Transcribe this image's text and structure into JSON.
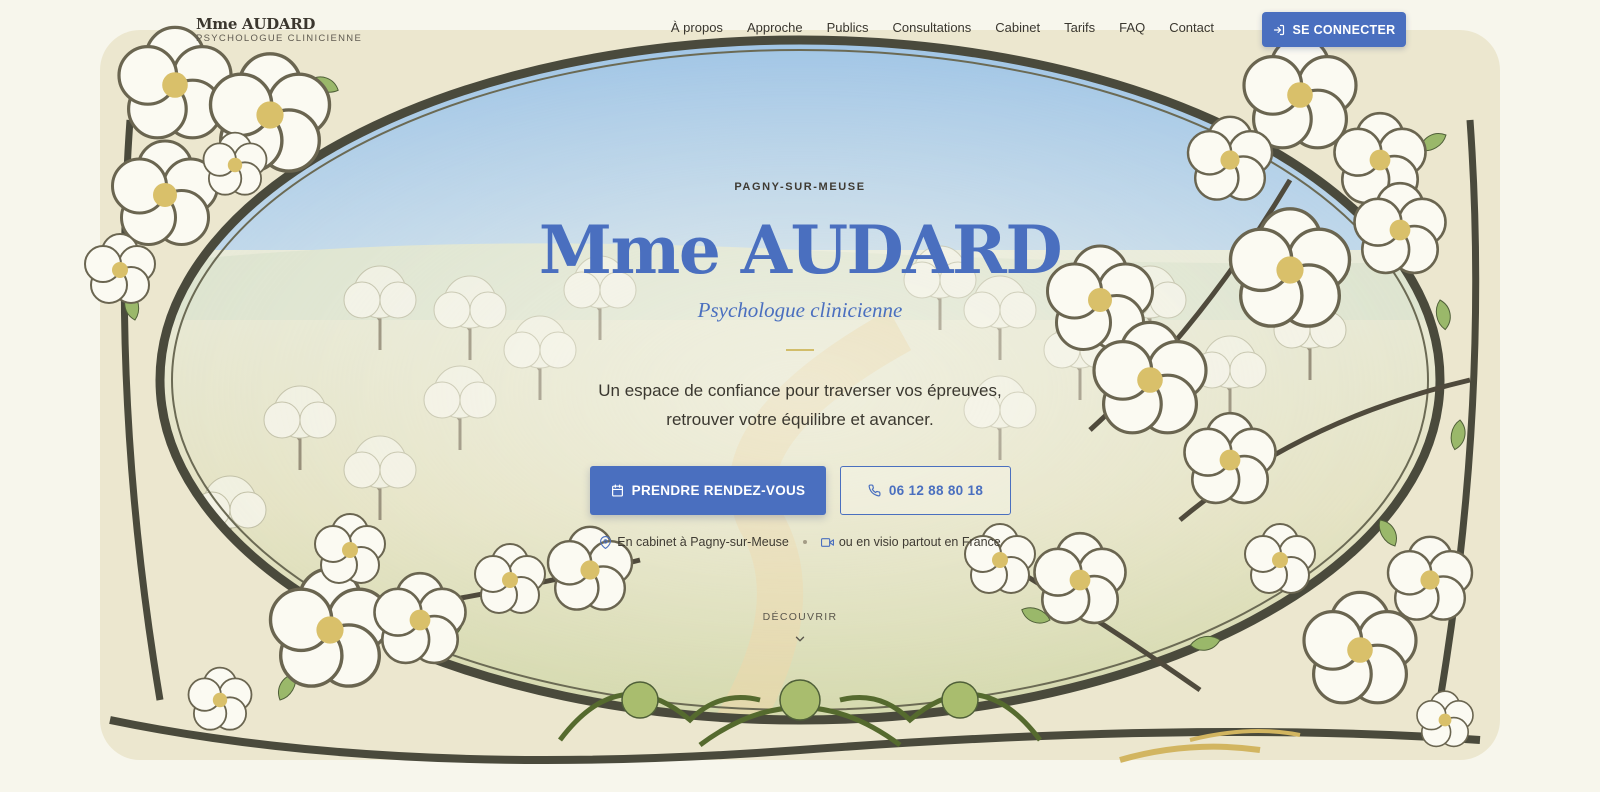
{
  "header": {
    "brand_name": "Mme AUDARD",
    "brand_sub": "PSYCHOLOGUE CLINICIENNE",
    "nav": [
      "À propos",
      "Approche",
      "Publics",
      "Consultations",
      "Cabinet",
      "Tarifs",
      "FAQ",
      "Contact"
    ],
    "login_label": "SE CONNECTER",
    "login_icon": "log-in-icon"
  },
  "hero": {
    "eyebrow": "PAGNY-SUR-MEUSE",
    "title": "Mme AUDARD",
    "subtitle": "Psychologue clinicienne",
    "intro_line1": "Un espace de confiance pour traverser vos épreuves,",
    "intro_line2": "retrouver votre équilibre et avancer.",
    "primary_cta": "PRENDRE RENDEZ-VOUS",
    "primary_icon": "calendar-icon",
    "phone_cta": "06 12 88 80 18",
    "phone_icon": "phone-icon",
    "location_office": "En cabinet à Pagny-sur-Meuse",
    "location_office_icon": "map-pin-icon",
    "location_visio": "ou en visio partout en France",
    "location_visio_icon": "video-icon",
    "discover": "DÉCOUVRIR",
    "discover_icon": "chevron-down-icon"
  },
  "colors": {
    "accent": "#4a6fbf",
    "background": "#f7f6ec",
    "gold": "#d2bd6a",
    "frame": "#4a4a3c"
  }
}
